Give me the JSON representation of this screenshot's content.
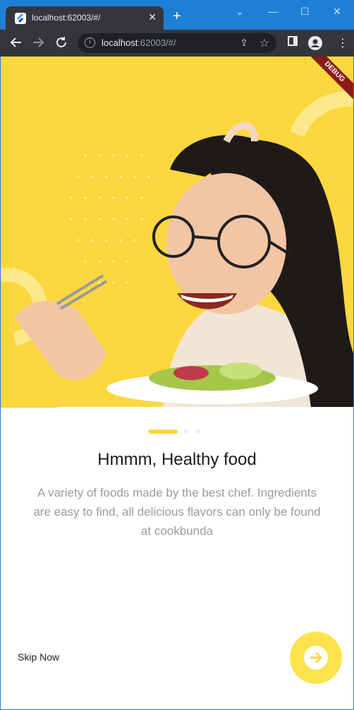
{
  "browser": {
    "tab_title": "localhost:62003/#/",
    "url_host": "localhost",
    "url_rest": ":62003/#/",
    "new_tab_label": "+",
    "close_tab_label": "✕",
    "minimize_label": "—",
    "maximize_label": "☐",
    "close_window_label": "✕",
    "dropdown_label": "⌄"
  },
  "debug_banner": "DEBUG",
  "onboarding": {
    "title": "Hmmm, Healthy food",
    "description": "A variety of foods made by the best chef. Ingredients are easy to find, all delicious flavors can only be found at cookbunda",
    "skip_label": "Skip Now",
    "page_index": 0,
    "page_count": 3
  },
  "colors": {
    "accent": "#fcd73f",
    "browser_chrome": "#35363a",
    "title_bar": "#1f7fd6"
  },
  "icons": {
    "back": "arrow-left-icon",
    "forward": "arrow-right-icon",
    "reload": "reload-icon",
    "next": "arrow-right-circle-icon"
  }
}
